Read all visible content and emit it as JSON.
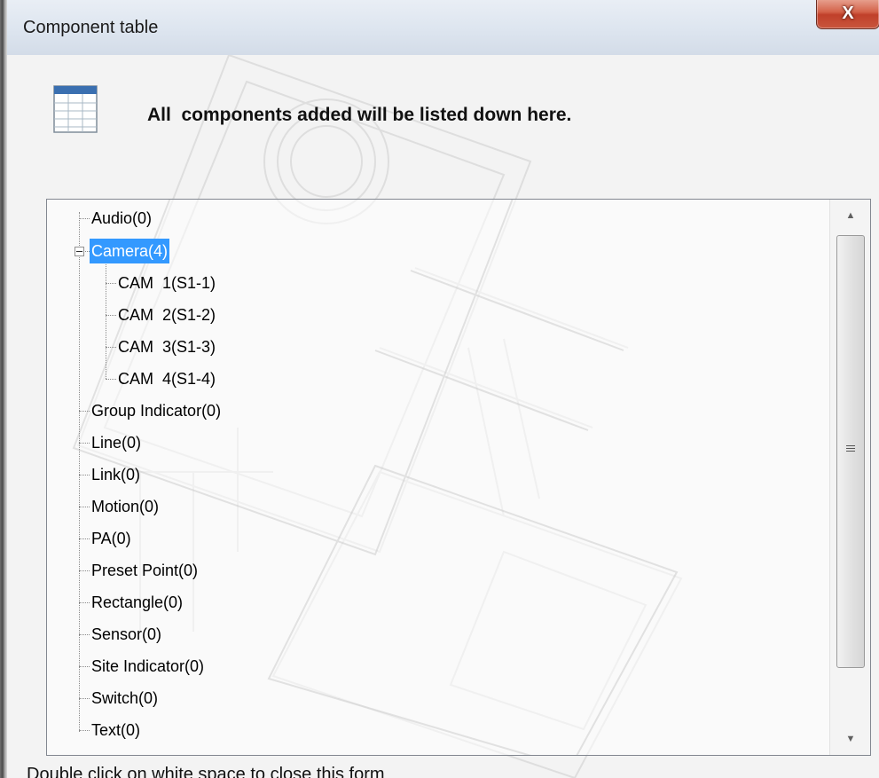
{
  "window": {
    "title": "Component table",
    "close_label": "X"
  },
  "header": {
    "message": "All  components added will be listed down here.",
    "icon": "table-icon"
  },
  "tree": {
    "items": [
      {
        "label": "Audio(0)",
        "level": 0
      },
      {
        "label": "Camera(4)",
        "level": 0,
        "expanded": true,
        "selected": true
      },
      {
        "label": "CAM  1(S1-1)",
        "level": 1
      },
      {
        "label": "CAM  2(S1-2)",
        "level": 1
      },
      {
        "label": "CAM  3(S1-3)",
        "level": 1
      },
      {
        "label": "CAM  4(S1-4)",
        "level": 1
      },
      {
        "label": "Group Indicator(0)",
        "level": 0
      },
      {
        "label": "Line(0)",
        "level": 0
      },
      {
        "label": "Link(0)",
        "level": 0
      },
      {
        "label": "Motion(0)",
        "level": 0
      },
      {
        "label": "PA(0)",
        "level": 0
      },
      {
        "label": "Preset Point(0)",
        "level": 0
      },
      {
        "label": "Rectangle(0)",
        "level": 0
      },
      {
        "label": "Sensor(0)",
        "level": 0
      },
      {
        "label": "Site Indicator(0)",
        "level": 0
      },
      {
        "label": "Switch(0)",
        "level": 0
      },
      {
        "label": "Text(0)",
        "level": 0
      }
    ]
  },
  "scrollbar": {
    "up_icon": "scroll-up-arrow-icon",
    "down_icon": "scroll-down-arrow-icon"
  },
  "status": {
    "text": "Double click on white space to close this form"
  },
  "colors": {
    "selection": "#3399ff",
    "close_button": "#c9563d"
  }
}
